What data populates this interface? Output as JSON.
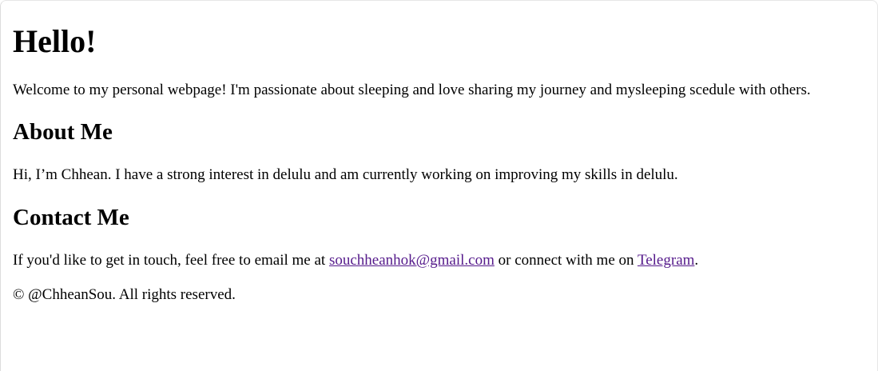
{
  "header": {
    "title": "Hello!"
  },
  "intro": {
    "text": "Welcome to my personal webpage! I'm passionate about sleeping and love sharing my journey and mysleeping scedule with others."
  },
  "about": {
    "heading": "About Me",
    "text": "Hi, I’m Chhean. I have a strong interest in delulu and am currently working on improving my skills in delulu."
  },
  "contact": {
    "heading": "Contact Me",
    "text_before_email": "If you'd like to get in touch, feel free to email me at ",
    "email_link": "souchheanhok@gmail.com",
    "text_between_links": " or connect with me on ",
    "telegram_link": "Telegram",
    "text_after_links": "."
  },
  "footer": {
    "copyright": "© @ChheanSou. All rights reserved."
  },
  "colors": {
    "text": "#000000",
    "visited_link": "#551a8b",
    "background": "#ffffff"
  }
}
